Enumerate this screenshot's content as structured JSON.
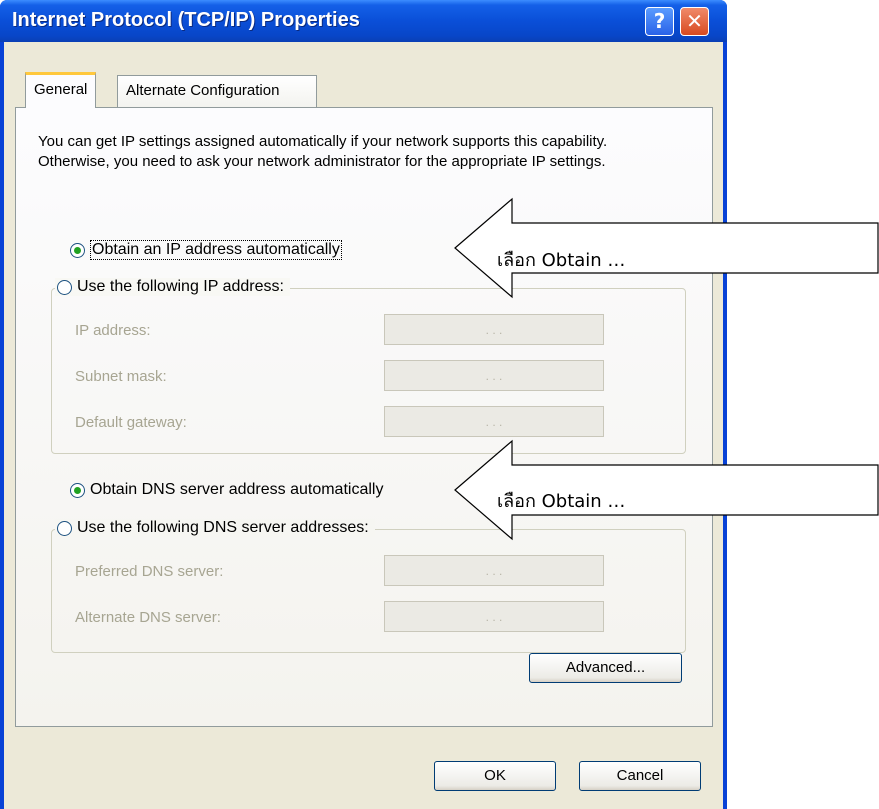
{
  "window": {
    "title": "Internet Protocol (TCP/IP) Properties",
    "help_glyph": "?",
    "close_glyph": "✕"
  },
  "tabs": [
    {
      "label": "General",
      "selected": true
    },
    {
      "label": "Alternate Configuration",
      "selected": false
    }
  ],
  "general": {
    "intro": "You can get IP settings assigned automatically if your network supports this capability. Otherwise, you need to ask your network administrator for the appropriate IP settings.",
    "ip_auto_label": "Obtain an IP address automatically",
    "ip_manual_label": "Use the following IP address:",
    "ip_fields": [
      {
        "label": "IP address:",
        "value": ". . ."
      },
      {
        "label": "Subnet mask:",
        "value": ". . ."
      },
      {
        "label": "Default gateway:",
        "value": ". . ."
      }
    ],
    "dns_auto_label": "Obtain DNS server address automatically",
    "dns_manual_label": "Use the following DNS server addresses:",
    "dns_fields": [
      {
        "label": "Preferred DNS server:",
        "value": ". . ."
      },
      {
        "label": "Alternate DNS server:",
        "value": ". . ."
      }
    ],
    "advanced_button": "Advanced..."
  },
  "footer": {
    "ok_button": "OK",
    "cancel_button": "Cancel"
  },
  "callouts": [
    {
      "text": "เลือก Obtain …"
    },
    {
      "text": "เลือก Obtain …"
    }
  ],
  "colors": {
    "titlebar": "#0a4fd8",
    "dialog_face": "#ece9d8",
    "radio_dot": "#21a121",
    "disabled_text": "#a7a592"
  }
}
